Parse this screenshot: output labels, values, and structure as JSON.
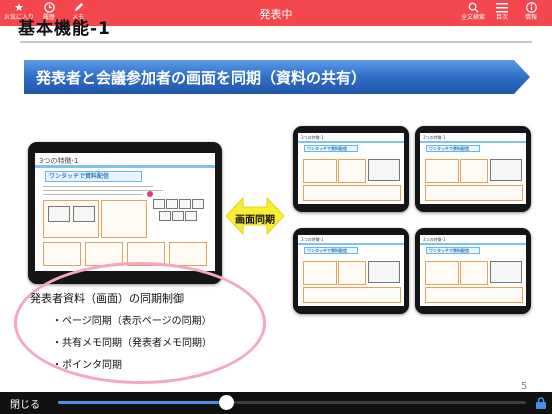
{
  "topbar": {
    "title": "発表中",
    "left_items": [
      {
        "label": "お気に入り",
        "icon": "star-icon"
      },
      {
        "label": "履歴",
        "icon": "clock-icon"
      },
      {
        "label": "メモ",
        "icon": "pen-icon"
      }
    ],
    "right_items": [
      {
        "label": "全文検索",
        "icon": "search-icon"
      },
      {
        "label": "目次",
        "icon": "list-icon"
      },
      {
        "label": "情報",
        "icon": "info-icon"
      }
    ],
    "color": "#f4474d"
  },
  "slide": {
    "title": "基本機能-1",
    "banner": "発表者と会議参加者の画面を同期（資料の共有）",
    "sync_label": "画面同期",
    "notes_heading": "発表者資料（画面）の同期制御",
    "notes": [
      "・ページ同期（表示ページの同期）",
      "・共有メモ同期（発表者メモ同期）",
      "・ポインタ同期"
    ],
    "page_number": "5",
    "main_screen": {
      "title": "3つの特徴-1",
      "heading": "ワンタッチで資料配信"
    },
    "small_screen": {
      "title": "3つの特徴-1",
      "heading": "ワンタッチで資料配信"
    }
  },
  "bottombar": {
    "close_label": "閉じる",
    "progress": 0.36
  },
  "colors": {
    "banner": "#2f6fc6",
    "accent_pink": "#f6a6c5",
    "slider": "#4a90e2"
  }
}
